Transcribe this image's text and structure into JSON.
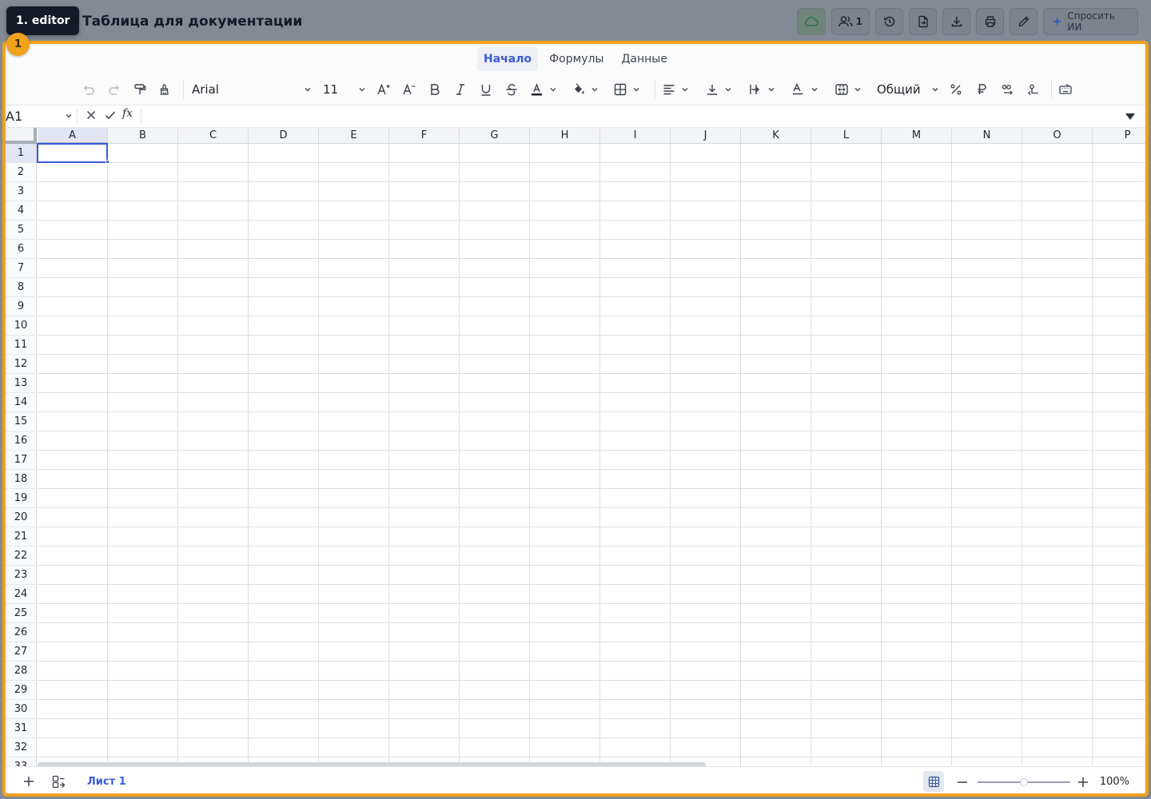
{
  "overlay": {
    "editor_badge": "1. editor",
    "marker": "1"
  },
  "header": {
    "title": "Таблица для документации",
    "users_count": "1",
    "ask_ai_label": "Спросить ИИ"
  },
  "menu": {
    "tabs": [
      "Начало",
      "Формулы",
      "Данные"
    ],
    "active_tab": "Начало"
  },
  "toolbar": {
    "font": "Arial",
    "font_size": "11",
    "number_format": "Общий"
  },
  "formula_bar": {
    "cell_ref": "A1",
    "fx_label": "fx",
    "formula": ""
  },
  "grid": {
    "columns": [
      "A",
      "B",
      "C",
      "D",
      "E",
      "F",
      "G",
      "H",
      "I",
      "J",
      "K",
      "L",
      "M",
      "N",
      "O",
      "P"
    ],
    "rows": [
      "1",
      "2",
      "3",
      "4",
      "5",
      "6",
      "7",
      "8",
      "9",
      "10",
      "11",
      "12",
      "13",
      "14",
      "15",
      "16",
      "17",
      "18",
      "19",
      "20",
      "21",
      "22",
      "23",
      "24",
      "25",
      "26",
      "27",
      "28",
      "29",
      "30",
      "31",
      "32",
      "33"
    ],
    "selected_cell": "A1"
  },
  "sheets": {
    "tabs": [
      "Лист 1"
    ],
    "active": "Лист 1"
  },
  "zoom": {
    "label": "100%",
    "level": 0.5
  },
  "colors": {
    "accent": "#3b5bdb",
    "frame": "#f0a21c",
    "badge_bg": "#141a26"
  }
}
